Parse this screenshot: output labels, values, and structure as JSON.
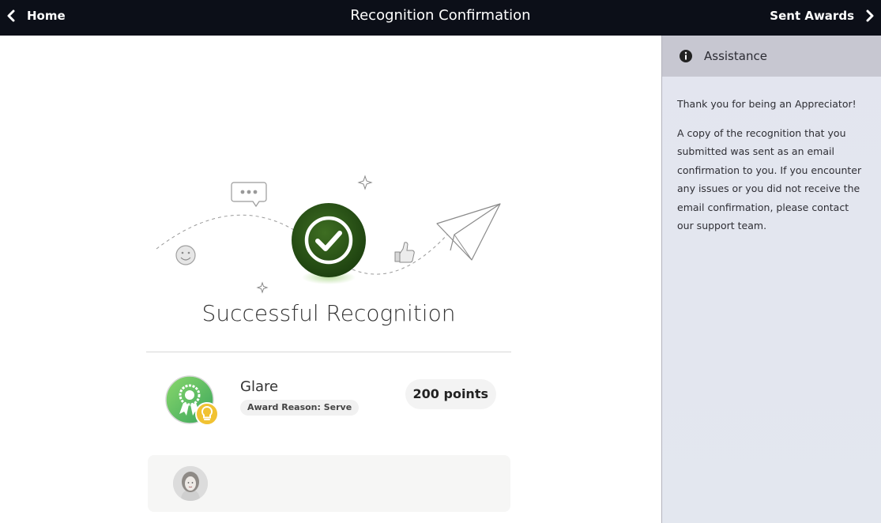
{
  "topbar": {
    "back_label": "Home",
    "title": "Recognition Confirmation",
    "forward_label": "Sent Awards"
  },
  "main": {
    "success_title": "Successful Recognition",
    "award": {
      "name": "Glare",
      "reason": "Award Reason: Serve",
      "points": "200 points"
    }
  },
  "side_panel": {
    "title": "Assistance",
    "paragraph_1": "Thank you for being an Appreciator!",
    "paragraph_2": "A copy of the recognition that you submitted was sent as an email confirmation to you. If you encounter any issues or you did not receive the email confirmation, please contact our support team."
  },
  "colors": {
    "topbar_bg": "#0c0f18",
    "success_green": "#2f5a1a",
    "panel_header_bg": "#c7c7d1",
    "panel_bg": "#e3e5ef",
    "badge_green": "#5cbf6a",
    "badge_yellow": "#f1c232"
  },
  "icons": {
    "back": "chevron-left-icon",
    "forward": "chevron-right-icon",
    "info": "info-circle-icon",
    "success": "check-circle-icon",
    "badge": "award-ribbon-icon",
    "bulb": "lightbulb-icon"
  }
}
